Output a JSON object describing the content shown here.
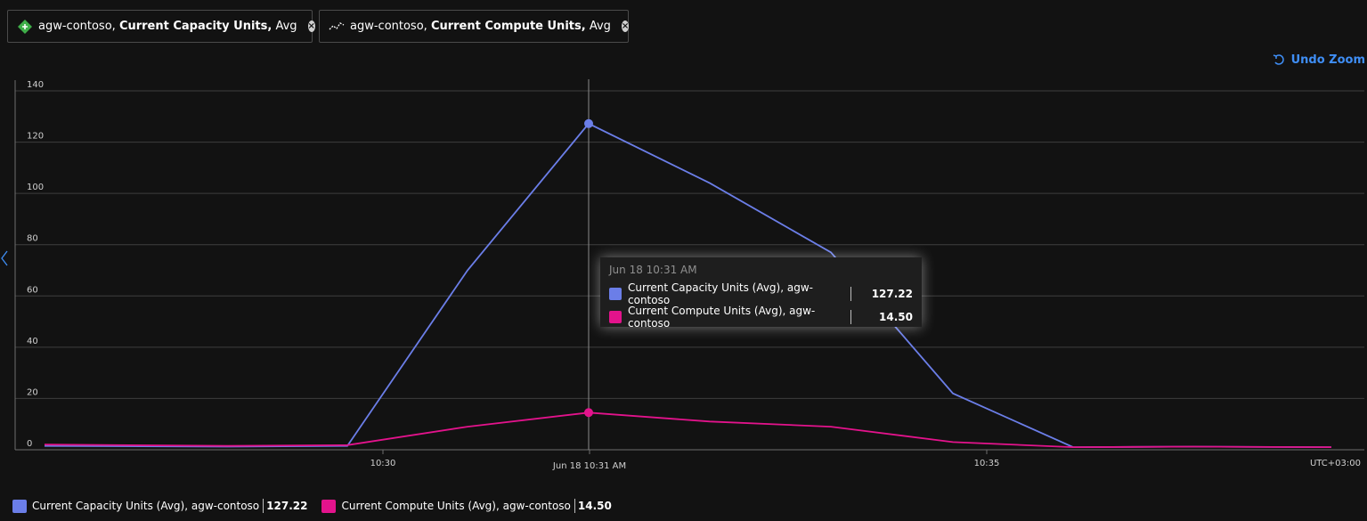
{
  "metric_chips": [
    {
      "resource": "agw-contoso,",
      "metric": "Current Capacity Units,",
      "agg": "Avg",
      "icon": "app-gateway-icon"
    },
    {
      "resource": "agw-contoso,",
      "metric": "Current Compute Units,",
      "agg": "Avg",
      "icon": "line-chart-icon"
    }
  ],
  "undo_zoom_label": "Undo Zoom",
  "chart_data": {
    "type": "line",
    "x": [
      "10:28",
      "10:29",
      "10:29:30",
      "10:30:30",
      "10:31",
      "10:32",
      "10:33",
      "10:34",
      "10:35",
      "10:36",
      "10:37"
    ],
    "x_tick_labels": [
      "10:30",
      "Jun 18 10:31 AM",
      "10:35"
    ],
    "timezone_label": "UTC+03:00",
    "ylim": [
      0,
      140
    ],
    "y_ticks": [
      0,
      20,
      40,
      60,
      80,
      100,
      120,
      140
    ],
    "grid": true,
    "series": [
      {
        "name": "Current Capacity Units (Avg), agw-contoso",
        "color": "#6b7ee8",
        "values": [
          1.5,
          1.2,
          1.5,
          70,
          127.22,
          104,
          77,
          22,
          1,
          1.2,
          1
        ]
      },
      {
        "name": "Current Compute Units (Avg), agw-contoso",
        "color": "#e3138c",
        "values": [
          2,
          1.5,
          1.8,
          9,
          14.5,
          11,
          9,
          3,
          1,
          1.2,
          1
        ]
      }
    ],
    "cursor": {
      "time": "Jun 18 10:31 AM",
      "values": [
        "127.22",
        "14.50"
      ]
    }
  },
  "legend": [
    {
      "label": "Current Capacity Units (Avg), agw-contoso",
      "value": "127.22",
      "color": "#6b7ee8"
    },
    {
      "label": "Current Compute Units (Avg), agw-contoso",
      "value": "14.50",
      "color": "#e3138c"
    }
  ]
}
